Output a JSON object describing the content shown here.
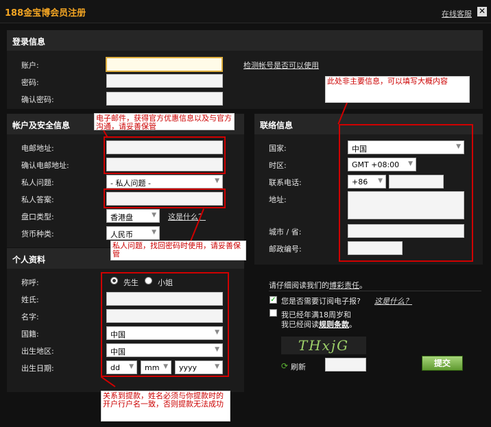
{
  "window": {
    "title": "188金宝博会员注册",
    "customer_service": "在线客服",
    "close": "✕"
  },
  "login": {
    "heading": "登录信息",
    "account_label": "账户:",
    "password_label": "密码:",
    "confirm_password_label": "确认密码:",
    "check_link": "检测帐号是否可以使用"
  },
  "security": {
    "heading": "帐户及安全信息",
    "email_label": "电邮地址:",
    "confirm_email_label": "确认电邮地址:",
    "question_label": "私人问题:",
    "question_value": "- 私人问题 -",
    "answer_label": "私人答案:",
    "odds_label": "盘口类型:",
    "odds_value": "香港盘",
    "what_link": "这是什么？",
    "currency_label": "货币种类:",
    "currency_value": "人民币"
  },
  "personal": {
    "heading": "个人资料",
    "salutation_label": "称呼:",
    "mr": "先生",
    "ms": "小姐",
    "surname_label": "姓氏:",
    "name_label": "名字:",
    "nationality_label": "国籍:",
    "nationality_value": "中国",
    "birthplace_label": "出生地区:",
    "birthplace_value": "中国",
    "dob_label": "出生日期:",
    "dd": "dd",
    "mm": "mm",
    "yyyy": "yyyy"
  },
  "contact": {
    "heading": "联络信息",
    "country_label": "国家:",
    "country_value": "中国",
    "timezone_label": "时区:",
    "timezone_value": "GMT +08:00",
    "phone_label": "联系电话:",
    "phone_code": "+86",
    "address_label": "地址:",
    "city_label": "城市 / 省:",
    "zip_label": "邮政编号:"
  },
  "terms": {
    "read_prefix": "请仔细阅读我们的",
    "responsible_link": "博彩责任",
    "read_suffix": "。",
    "newsletter": "您是否需要订阅电子报?",
    "newsletter_link": "这是什么？",
    "age_line1": "我已经年满18周岁和",
    "age_line2_prefix": "我已经阅读",
    "rules_link": "规则条款",
    "age_line2_suffix": "。",
    "captcha": "THxjG",
    "refresh": "刷新",
    "submit": "提交"
  },
  "annotations": {
    "contact_note": "此处非主要信息，可以填写大概内容",
    "email_note": "电子邮件，获得官方优惠信息以及与官方沟通，请妥善保管",
    "question_note": "私人问题，找回密码时使用，请妥善保管",
    "name_note": "关系到提款，姓名必须与你提款时的开户行户名一致，否则提款无法成功"
  },
  "colors": {
    "title": "#f5a623",
    "annotation_red": "#d00000",
    "submit_green": "#5f9a30"
  }
}
